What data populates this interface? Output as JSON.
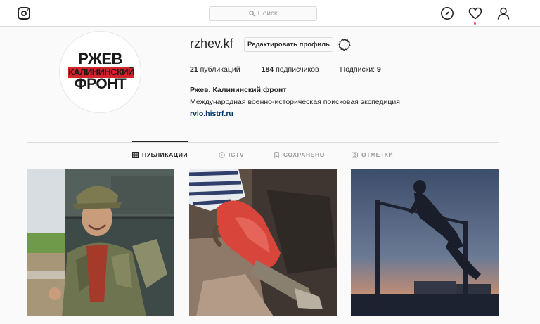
{
  "nav": {
    "search_placeholder": "Поиск",
    "icons": [
      "instagram-icon",
      "search-icon",
      "compass-icon",
      "heart-icon",
      "user-icon"
    ]
  },
  "profile": {
    "username": "rzhev.kf",
    "edit_button": "Редактировать профиль",
    "posts_count": "21",
    "posts_label": "публикаций",
    "followers_count": "184",
    "followers_label": "подписчиков",
    "following_label": "Подписки:",
    "following_count": "9",
    "full_name": "Ржев. Калининский фронт",
    "bio": "Международная военно-историческая поисковая экспедиция",
    "website": "rvio.histrf.ru",
    "avatar_logo": {
      "line1": "РЖЕВ",
      "line2": "КАЛИНИНСКИЙ",
      "line3": "ФРОНТ"
    }
  },
  "tabs": [
    {
      "label": "ПУБЛИКАЦИИ",
      "icon": "grid-icon",
      "active": true
    },
    {
      "label": "IGTV",
      "icon": "igtv-icon",
      "active": false
    },
    {
      "label": "СОХРАНЕНО",
      "icon": "bookmark-icon",
      "active": false
    },
    {
      "label": "ОТМЕТКИ",
      "icon": "tagged-icon",
      "active": false
    }
  ],
  "posts": [
    {
      "subject": "soldier-smiling-photo"
    },
    {
      "subject": "gloved-hand-digging-photo"
    },
    {
      "subject": "silhouette-on-bar-photo"
    }
  ],
  "colors": {
    "background": "#fafafa",
    "border": "#dbdbdb",
    "text": "#262626",
    "muted": "#999999",
    "link": "#003569",
    "notification": "#ed4956",
    "logo_red": "#d2232a"
  }
}
